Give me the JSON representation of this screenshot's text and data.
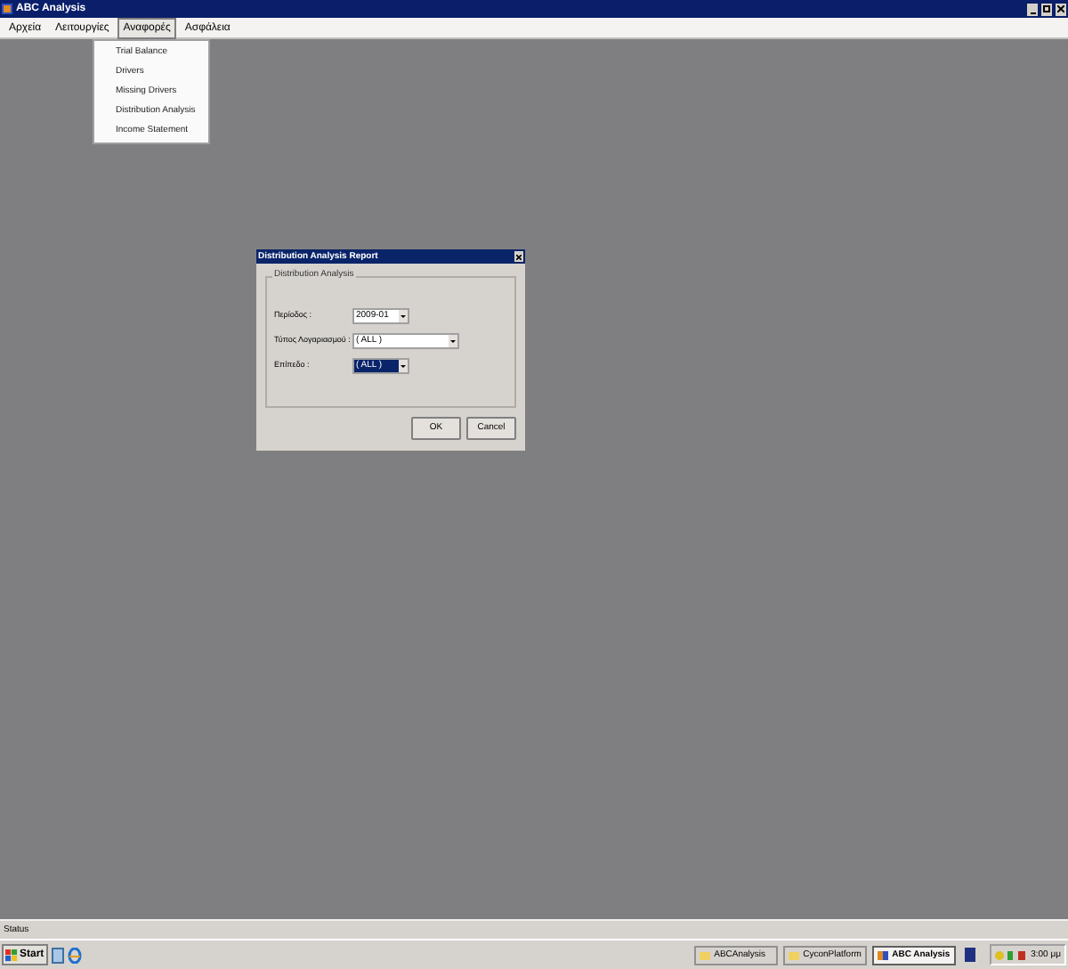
{
  "window": {
    "title": "ABC Analysis"
  },
  "menu": [
    {
      "label": "Αρχεία",
      "selected": false
    },
    {
      "label": "Λειτουργίες",
      "selected": false
    },
    {
      "label": "Αναφορές",
      "selected": true
    },
    {
      "label": "Ασφάλεια",
      "selected": false
    }
  ],
  "dropdown": [
    "Trial Balance",
    "Drivers",
    "Missing Drivers",
    "Distribution Analysis",
    "Income Statement"
  ],
  "dialog": {
    "title": "Distribution Analysis Report",
    "group_title": "Distribution Analysis",
    "fields": [
      {
        "label": "Περίοδος :",
        "value": "2009-01",
        "selected": false,
        "wide": false
      },
      {
        "label": "Τύπος Λογαριασμού :",
        "value": "( ALL )",
        "selected": false,
        "wide": true
      },
      {
        "label": "Επίπεδο :",
        "value": "( ALL )",
        "selected": true,
        "wide": false
      }
    ],
    "buttons": [
      "OK",
      "Cancel"
    ]
  },
  "status_bar": "Status",
  "taskbar": {
    "start": "Start",
    "tasks": [
      {
        "label": "ABCAnalysis",
        "selected": false,
        "kind": "folder"
      },
      {
        "label": "CyconPlatform",
        "selected": false,
        "kind": "folder"
      },
      {
        "label": "ABC Analysis",
        "selected": true,
        "kind": "app"
      }
    ],
    "clock": "3:00 μμ"
  }
}
